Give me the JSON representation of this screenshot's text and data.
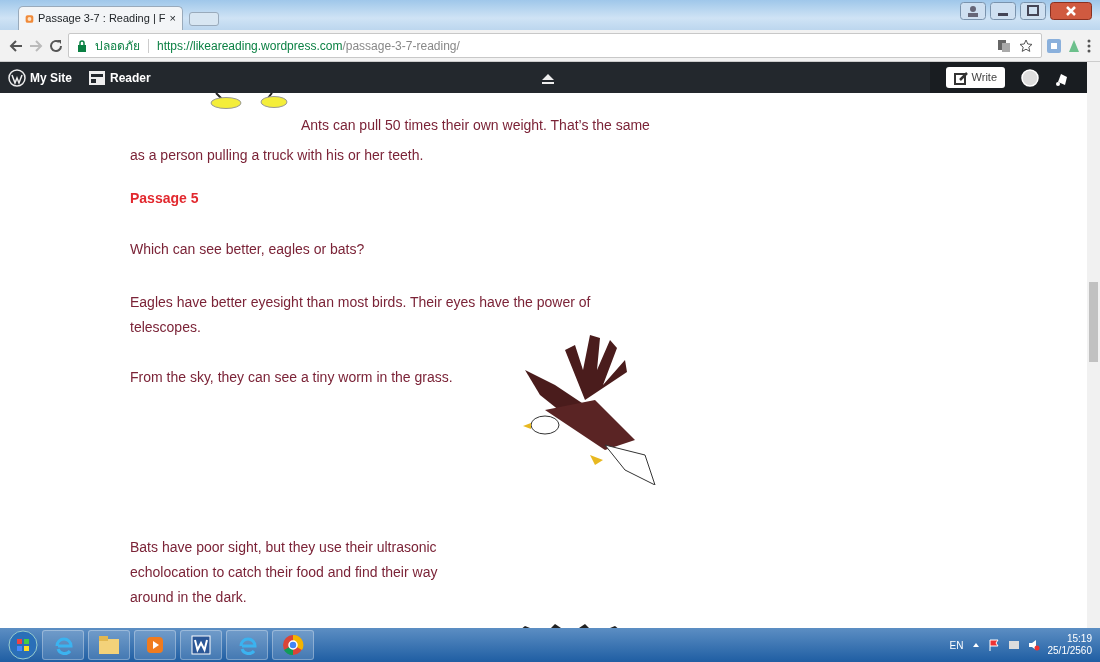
{
  "browser": {
    "tabs": [
      {
        "title": "Passage 3-7 : Reading | F",
        "selected": true
      }
    ],
    "close_glyph": "×",
    "secure_label": "ปลอดภัย",
    "url_host": "https://likeareading.wordpress.com",
    "url_path": "/passage-3-7-reading/"
  },
  "admin_bar": {
    "items": [
      {
        "kind": "wordpress",
        "label": "My Site"
      },
      {
        "kind": "reader",
        "label": "Reader"
      }
    ],
    "write_label": "Write"
  },
  "article": {
    "ants_text": "Ants can pull 50 times their own weight. That’s the same as a person pulling a truck with his or her teeth.",
    "heading": "Passage 5",
    "paragraphs": [
      "Which can see better, eagles or bats?",
      "Eagles have better eyesight than most birds. Their eyes have the power of telescopes.",
      "From the sky, they can see a tiny worm in the grass."
    ],
    "bats_text": "Bats have poor sight, but they use their ultrasonic echolocation to catch their food and find their way around in the dark."
  },
  "taskbar": {
    "apps": [
      {
        "kind": "ie"
      },
      {
        "kind": "folder"
      },
      {
        "kind": "media"
      },
      {
        "kind": "word"
      },
      {
        "kind": "ie"
      },
      {
        "kind": "chrome"
      }
    ],
    "language": "EN",
    "time": "15:19",
    "date": "25/1/2560"
  }
}
